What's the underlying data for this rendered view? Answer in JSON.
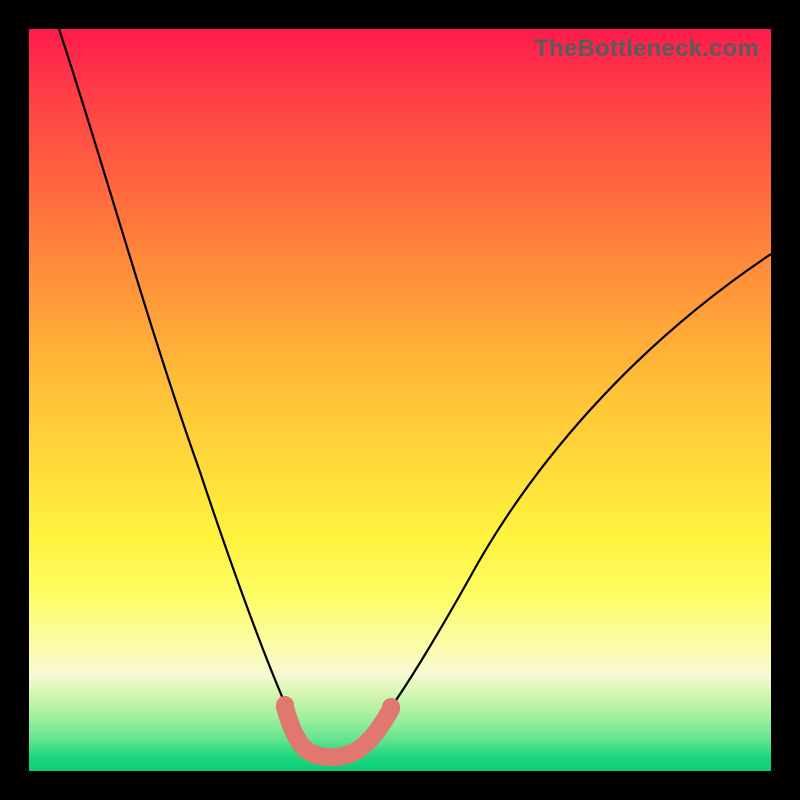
{
  "watermark": {
    "text": "TheBottleneck.com"
  },
  "colors": {
    "frame": "#000000",
    "curve": "#000000",
    "highlight": "#e0786f",
    "gradient_top": "#ff1a4b",
    "gradient_bottom": "#06cf77"
  },
  "chart_data": {
    "type": "line",
    "title": "",
    "xlabel": "",
    "ylabel": "",
    "xlim": [
      0,
      100
    ],
    "ylim": [
      0,
      100
    ],
    "axes_visible": false,
    "grid": false,
    "legend": false,
    "background": "red-to-green vertical gradient (bottleneck heatmap)",
    "series": [
      {
        "name": "bottleneck-curve",
        "x": [
          4,
          10,
          15,
          20,
          24,
          27,
          30,
          32.5,
          34.5,
          36,
          38,
          40,
          42,
          44,
          46,
          48.5,
          52,
          58,
          65,
          73,
          82,
          92,
          100
        ],
        "values": [
          100,
          85,
          72,
          58,
          46,
          36,
          26,
          17,
          10,
          5.5,
          3,
          2.2,
          2.2,
          2.6,
          4.5,
          8,
          14,
          24,
          35,
          45,
          54,
          63,
          70
        ]
      }
    ],
    "highlight_region": {
      "description": "flat pink band at valley floor",
      "x_start": 34.5,
      "x_end": 48.5,
      "y_approx": 2.5,
      "rendered_as": "thick rounded pink stroke"
    }
  }
}
